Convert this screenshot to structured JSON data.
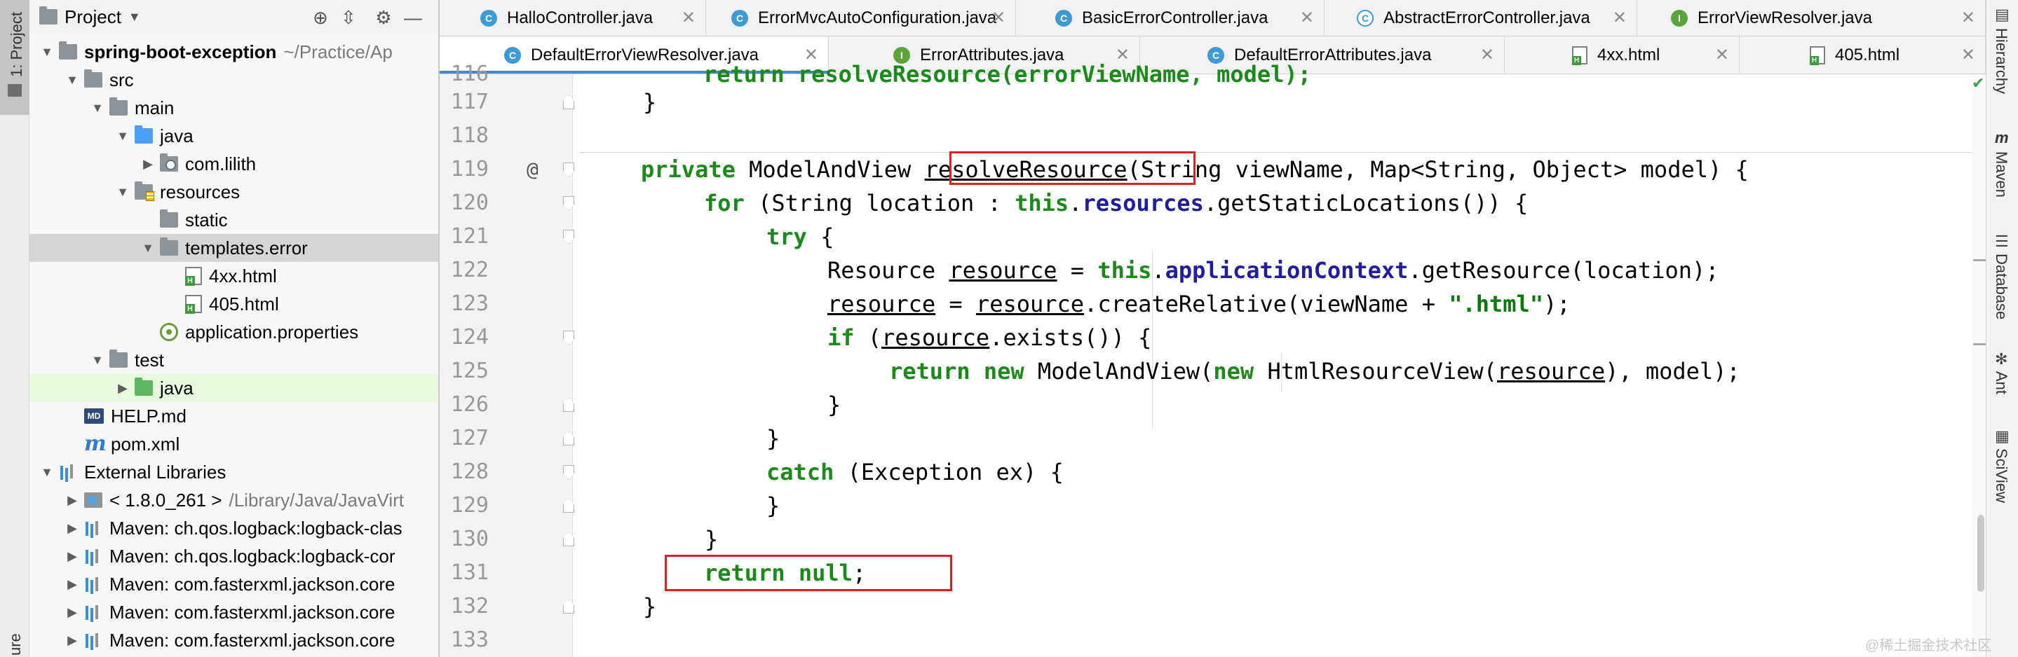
{
  "left_strip": {
    "project_tab": "1: Project",
    "structure_tab": "ure"
  },
  "project_panel": {
    "header_title": "Project",
    "tree": [
      {
        "label": "spring-boot-exception",
        "path": "~/Practice/Ap"
      },
      {
        "label": "src"
      },
      {
        "label": "main"
      },
      {
        "label": "java"
      },
      {
        "label": "com.lilith"
      },
      {
        "label": "resources"
      },
      {
        "label": "static"
      },
      {
        "label": "templates.error"
      },
      {
        "label": "4xx.html"
      },
      {
        "label": "405.html"
      },
      {
        "label": "application.properties"
      },
      {
        "label": "test"
      },
      {
        "label": "java"
      },
      {
        "label": "HELP.md"
      },
      {
        "label": "pom.xml"
      },
      {
        "label": "External Libraries"
      },
      {
        "label": "< 1.8.0_261 >",
        "path": "/Library/Java/JavaVirt"
      },
      {
        "label": "Maven: ch.qos.logback:logback-clas"
      },
      {
        "label": "Maven: ch.qos.logback:logback-cor"
      },
      {
        "label": "Maven: com.fasterxml.jackson.core"
      },
      {
        "label": "Maven: com.fasterxml.jackson.core"
      },
      {
        "label": "Maven: com.fasterxml.jackson.core"
      }
    ]
  },
  "tabs_row_1": [
    {
      "label": "HalloController.java",
      "kind": "class"
    },
    {
      "label": "ErrorMvcAutoConfiguration.java",
      "kind": "class"
    },
    {
      "label": "BasicErrorController.java",
      "kind": "class"
    },
    {
      "label": "AbstractErrorController.java",
      "kind": "abstract-class"
    },
    {
      "label": "ErrorViewResolver.java",
      "kind": "interface"
    }
  ],
  "tabs_row_2": [
    {
      "label": "DefaultErrorViewResolver.java",
      "kind": "class",
      "active": true
    },
    {
      "label": "ErrorAttributes.java",
      "kind": "interface"
    },
    {
      "label": "DefaultErrorAttributes.java",
      "kind": "class"
    },
    {
      "label": "4xx.html",
      "kind": "html"
    },
    {
      "label": "405.html",
      "kind": "html"
    }
  ],
  "tab_close_glyph": "✕",
  "code": {
    "line_numbers": [
      "116",
      "117",
      "118",
      "119",
      "120",
      "121",
      "122",
      "123",
      "124",
      "125",
      "126",
      "127",
      "128",
      "129",
      "130",
      "131",
      "132",
      "133"
    ],
    "lines": {
      "l116_partial": "return resolveResource(errorViewName, model);",
      "l117": "}",
      "l119_private": "private",
      "l119_type": "ModelAndView",
      "l119_name": "resolveResource",
      "l119_params": "(String viewName, Map<String, Object> model) {",
      "l120_for": "for",
      "l120_mid": "(String location :",
      "l120_this": "this",
      "l120_resources": "resources",
      "l120_rest": ".getStaticLocations()) {",
      "l121_try": "try",
      "l121_rest": "{",
      "l122_type": "Resource",
      "l122_var": "resource",
      "l122_eq": "=",
      "l122_this": "this",
      "l122_ctx": "applicationContext",
      "l122_rest": ".getResource(location);",
      "l123_var": "resource",
      "l123_eq": "=",
      "l123_var2": "resource",
      "l123_mid": ".createRelative(viewName +",
      "l123_str": "\".html\"",
      "l123_end": ");",
      "l124_if": "if",
      "l124_open": "(",
      "l124_var": "resource",
      "l124_rest": ".exists()) {",
      "l125_return": "return",
      "l125_new": "new",
      "l125_mid": "ModelAndView(",
      "l125_new2": "new",
      "l125_mid2": "HtmlResourceView(",
      "l125_var": "resource",
      "l125_end": "), model);",
      "l126": "}",
      "l127": "}",
      "l128_catch": "catch",
      "l128_rest": "(Exception ex) {",
      "l129": "}",
      "l130": "}",
      "l131_return": "return",
      "l131_null": "null",
      "l131_end": ";",
      "l132": "}"
    },
    "gutter_marker": "@"
  },
  "right_strip": [
    "Hierarchy",
    "Maven",
    "Database",
    "Ant",
    "SciView"
  ],
  "watermark": "@稀土掘金技术社区",
  "colors": {
    "keyword": "#1b8a1b",
    "field": "#221d9e",
    "string": "#0a7a0a",
    "annotation_box": "#e02020",
    "active_tab_underline": "#4a88c7"
  }
}
